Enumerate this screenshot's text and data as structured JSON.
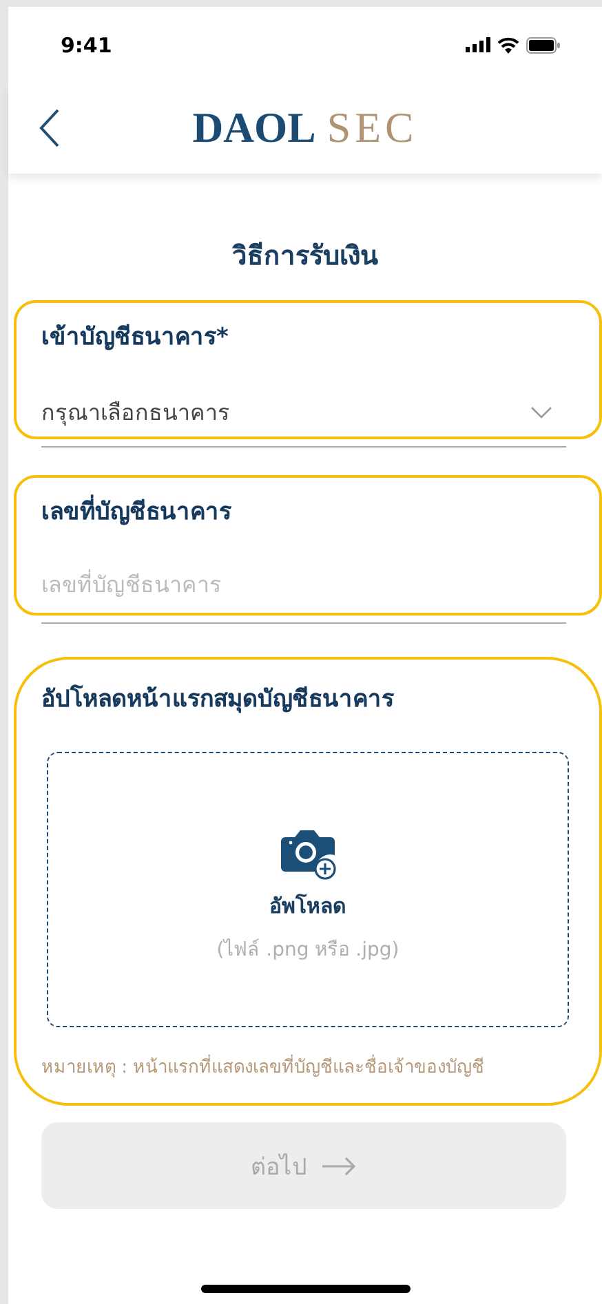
{
  "status_bar": {
    "time": "9:41"
  },
  "header": {
    "logo_primary": "DAOL",
    "logo_secondary": "SEC"
  },
  "title": "วิธีการรับเงิน",
  "fields": [
    {
      "kind": "select",
      "label": "เข้าบัญชีธนาคาร*",
      "value": "กรุณาเลือกธนาคาร",
      "highlighted": true
    },
    {
      "kind": "input",
      "label": "เลขที่บัญชีธนาคาร",
      "placeholder": "เลขที่บัญชีธนาคาร",
      "highlighted": true
    }
  ],
  "upload": {
    "heading": "อัปโหลดหน้าแรกสมุดบัญชีธนาคาร",
    "action": "อัพโหลด",
    "hint": "(ไฟล์ .png หรือ .jpg)",
    "note": "หมายเหตุ : หน้าแรกที่แสดงเลขที่บัญชีและชื่อเจ้าของบัญชี",
    "highlighted": true
  },
  "next_button": {
    "label": "ต่อไป",
    "disabled": true
  }
}
